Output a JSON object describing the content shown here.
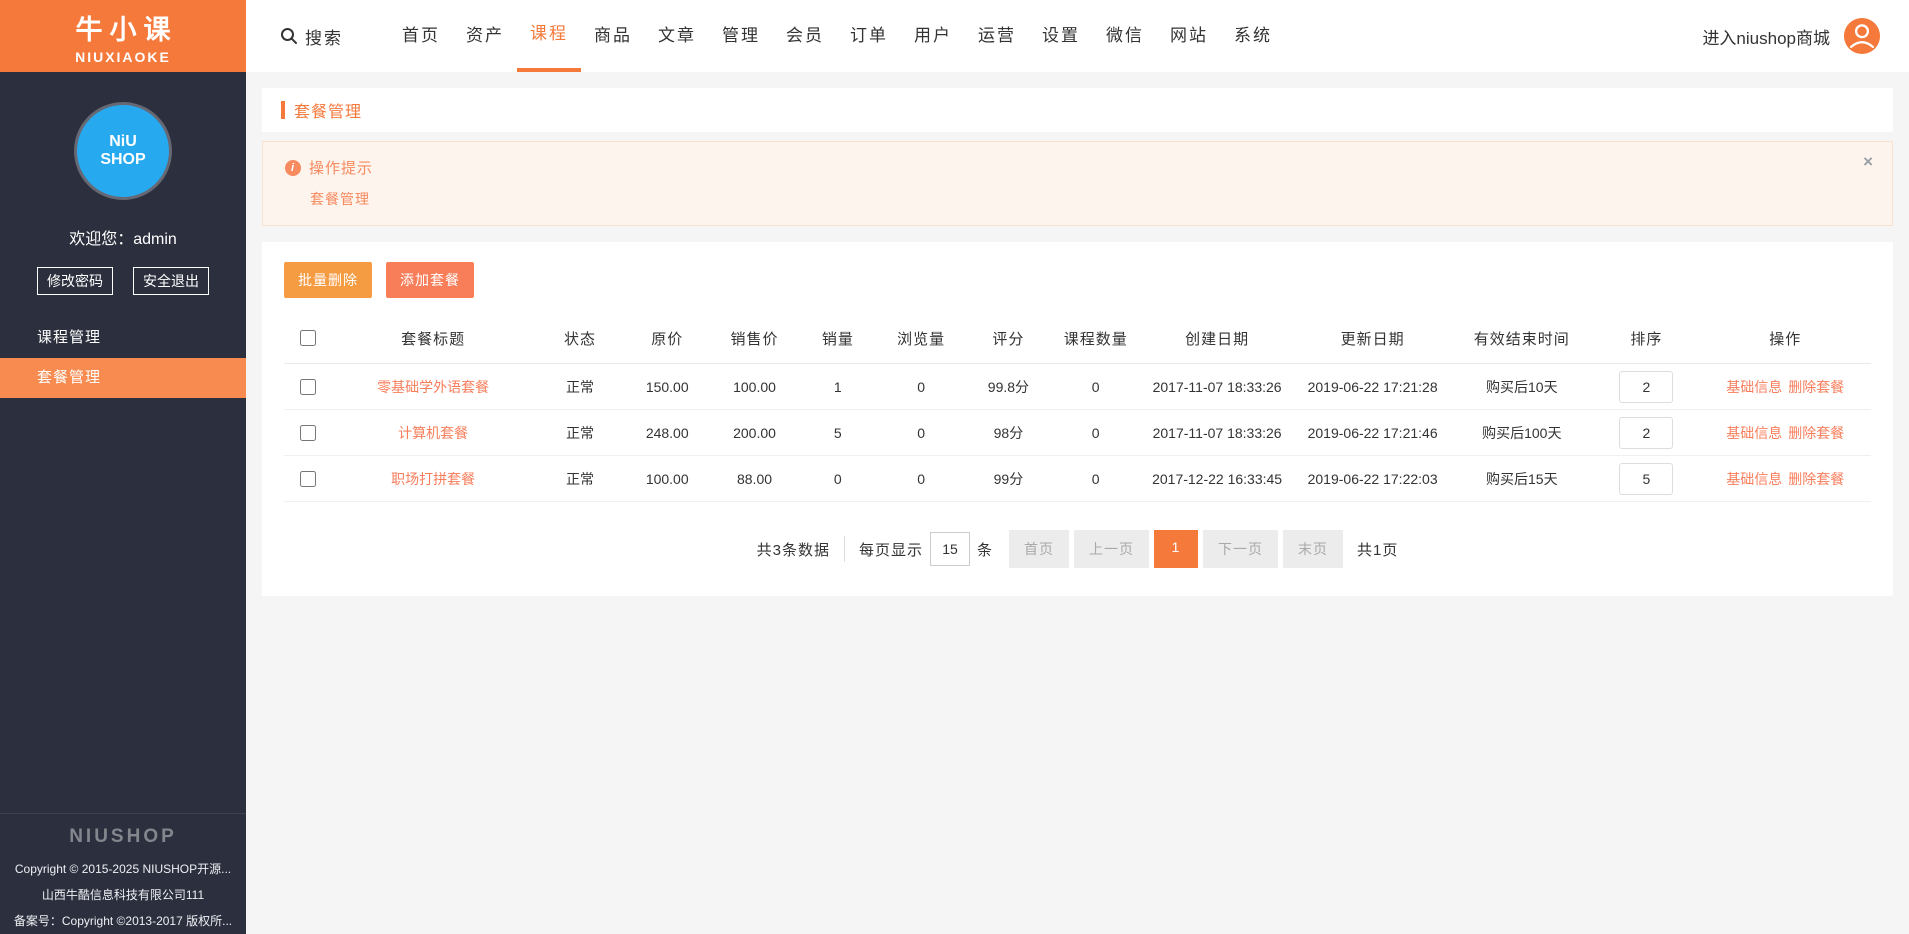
{
  "colors": {
    "accent": "#f5793b",
    "salmon_link": "#f87e5b",
    "sidebar_bg": "#2c2f3d",
    "active_item": "#f78b50",
    "btn_batch": "#f59b41",
    "btn_add": "#f87e5a",
    "pagination_active": "#f5793b",
    "logo_blue": "#27a9f0",
    "alert_bg": "#fdf4ee",
    "alert_border": "#f8e1cf",
    "alert_text": "#f78a5e"
  },
  "brand": {
    "logo_title": "牛小课",
    "logo_subtitle": "NIUXIAOKE",
    "circle_line1": "NiU",
    "circle_line2": "SHOP",
    "footer_logo": "NIUSHOP"
  },
  "sidebar": {
    "welcome": "欢迎您：admin",
    "buttons": [
      "修改密码",
      "安全退出"
    ],
    "menu": [
      {
        "label": "课程管理",
        "active": false
      },
      {
        "label": "套餐管理",
        "active": true
      }
    ],
    "footer_lines": [
      "Copyright © 2015-2025 NIUSHOP开源...",
      "山西牛酷信息科技有限公司111",
      "备案号：Copyright ©2013-2017 版权所..."
    ]
  },
  "topbar": {
    "search_label": "搜索",
    "nav": [
      {
        "label": "首页",
        "active": false
      },
      {
        "label": "资产",
        "active": false
      },
      {
        "label": "课程",
        "active": true
      },
      {
        "label": "商品",
        "active": false
      },
      {
        "label": "文章",
        "active": false
      },
      {
        "label": "管理",
        "active": false
      },
      {
        "label": "会员",
        "active": false
      },
      {
        "label": "订单",
        "active": false
      },
      {
        "label": "用户",
        "active": false
      },
      {
        "label": "运营",
        "active": false
      },
      {
        "label": "设置",
        "active": false
      },
      {
        "label": "微信",
        "active": false
      },
      {
        "label": "网站",
        "active": false
      },
      {
        "label": "系统",
        "active": false
      }
    ],
    "store_link": "进入niushop商城"
  },
  "page": {
    "title": "套餐管理"
  },
  "alert": {
    "title": "操作提示",
    "body": "套餐管理",
    "info_glyph": "i",
    "close_icon": "×"
  },
  "toolbar": {
    "batch_delete": "批量删除",
    "add_package": "添加套餐"
  },
  "table": {
    "headers": [
      "套餐标题",
      "状态",
      "原价",
      "销售价",
      "销量",
      "浏览量",
      "评分",
      "课程数量",
      "创建日期",
      "更新日期",
      "有效结束时间",
      "排序",
      "操作"
    ],
    "rows": [
      {
        "title": "零基础学外语套餐",
        "status": "正常",
        "price": "150.00",
        "sale_price": "100.00",
        "sales": "1",
        "views": "0",
        "score": "99.8分",
        "course_count": "0",
        "created": "2017-11-07 18:33:26",
        "updated": "2019-06-22 17:21:28",
        "valid_end": "购买后10天",
        "sort": "2",
        "actions": [
          "基础信息",
          "删除套餐"
        ]
      },
      {
        "title": "计算机套餐",
        "status": "正常",
        "price": "248.00",
        "sale_price": "200.00",
        "sales": "5",
        "views": "0",
        "score": "98分",
        "course_count": "0",
        "created": "2017-11-07 18:33:26",
        "updated": "2019-06-22 17:21:46",
        "valid_end": "购买后100天",
        "sort": "2",
        "actions": [
          "基础信息",
          "删除套餐"
        ]
      },
      {
        "title": "职场打拼套餐",
        "status": "正常",
        "price": "100.00",
        "sale_price": "88.00",
        "sales": "0",
        "views": "0",
        "score": "99分",
        "course_count": "0",
        "created": "2017-12-22 16:33:45",
        "updated": "2019-06-22 17:22:03",
        "valid_end": "购买后15天",
        "sort": "5",
        "actions": [
          "基础信息",
          "删除套餐"
        ]
      }
    ]
  },
  "pagination": {
    "total_text": "共3条数据",
    "per_page_label": "每页显示",
    "per_page_value": "15",
    "unit": "条",
    "first": "首页",
    "prev": "上一页",
    "current": "1",
    "next": "下一页",
    "last": "末页",
    "total_pages": "共1页"
  }
}
